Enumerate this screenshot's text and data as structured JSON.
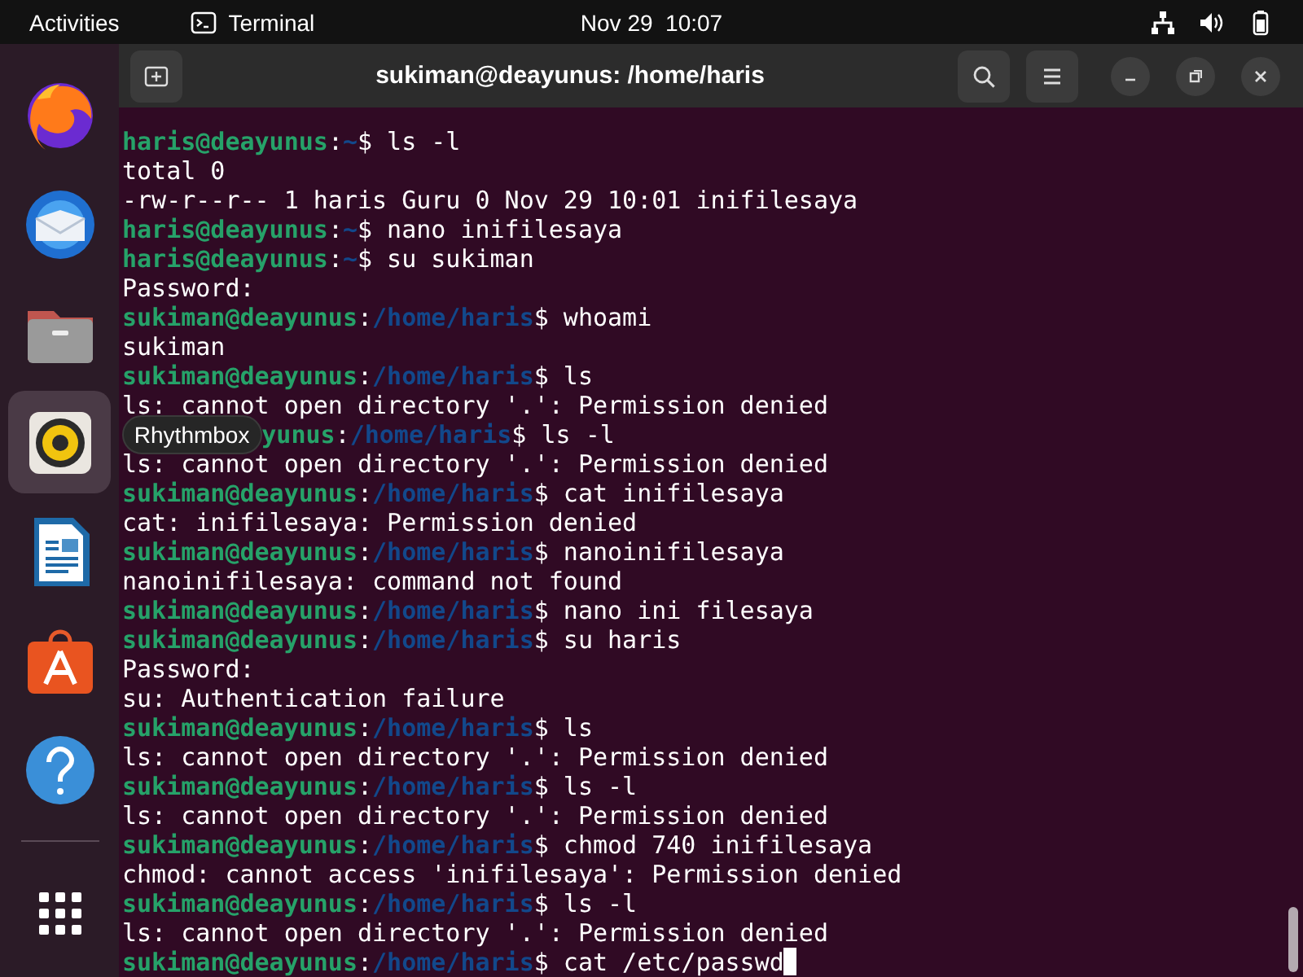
{
  "top_bar": {
    "activities": "Activities",
    "app_name": "Terminal",
    "clock": "Nov 29  10:07"
  },
  "dock": {
    "items": [
      {
        "kind": "browser",
        "hovered": false
      },
      {
        "kind": "mail",
        "hovered": false
      },
      {
        "kind": "files",
        "hovered": false
      },
      {
        "kind": "music",
        "hovered": true
      },
      {
        "kind": "writer",
        "hovered": false
      },
      {
        "kind": "store",
        "hovered": false
      },
      {
        "kind": "help",
        "hovered": false
      }
    ]
  },
  "window": {
    "title": "sukiman@deayunus: /home/haris"
  },
  "terminal": {
    "lines": [
      {
        "kind": "prompt",
        "user_host": "haris@deayunus",
        "sep": ":",
        "path": "~",
        "rest": "$ ls -l"
      },
      {
        "kind": "output",
        "text": "total 0"
      },
      {
        "kind": "output",
        "text": "-rw-r--r-- 1 haris Guru 0 Nov 29 10:01 inifilesaya"
      },
      {
        "kind": "prompt",
        "user_host": "haris@deayunus",
        "sep": ":",
        "path": "~",
        "rest": "$ nano inifilesaya"
      },
      {
        "kind": "prompt",
        "user_host": "haris@deayunus",
        "sep": ":",
        "path": "~",
        "rest": "$ su sukiman"
      },
      {
        "kind": "output",
        "text": "Password:"
      },
      {
        "kind": "prompt",
        "user_host": "sukiman@deayunus",
        "sep": ":",
        "path": "/home/haris",
        "rest": "$ whoami"
      },
      {
        "kind": "output",
        "text": "sukiman"
      },
      {
        "kind": "prompt",
        "user_host": "sukiman@deayunus",
        "sep": ":",
        "path": "/home/haris",
        "rest": "$ ls"
      },
      {
        "kind": "output",
        "text": "ls: cannot open directory '.': Permission denied"
      },
      {
        "kind": "prompt",
        "tooltip": "Rhythmbox",
        "user_host": "yunus",
        "sep": ":",
        "path": "/home/haris",
        "rest": "$ ls -l"
      },
      {
        "kind": "output",
        "text": "ls: cannot open directory '.': Permission denied"
      },
      {
        "kind": "prompt",
        "user_host": "sukiman@deayunus",
        "sep": ":",
        "path": "/home/haris",
        "rest": "$ cat inifilesaya"
      },
      {
        "kind": "output",
        "text": "cat: inifilesaya: Permission denied"
      },
      {
        "kind": "prompt",
        "user_host": "sukiman@deayunus",
        "sep": ":",
        "path": "/home/haris",
        "rest": "$ nanoinifilesaya"
      },
      {
        "kind": "output",
        "text": "nanoinifilesaya: command not found"
      },
      {
        "kind": "prompt",
        "user_host": "sukiman@deayunus",
        "sep": ":",
        "path": "/home/haris",
        "rest": "$ nano ini filesaya"
      },
      {
        "kind": "prompt",
        "user_host": "sukiman@deayunus",
        "sep": ":",
        "path": "/home/haris",
        "rest": "$ su haris"
      },
      {
        "kind": "output",
        "text": "Password:"
      },
      {
        "kind": "output",
        "text": "su: Authentication failure"
      },
      {
        "kind": "prompt",
        "user_host": "sukiman@deayunus",
        "sep": ":",
        "path": "/home/haris",
        "rest": "$ ls"
      },
      {
        "kind": "output",
        "text": "ls: cannot open directory '.': Permission denied"
      },
      {
        "kind": "prompt",
        "user_host": "sukiman@deayunus",
        "sep": ":",
        "path": "/home/haris",
        "rest": "$ ls -l"
      },
      {
        "kind": "output",
        "text": "ls: cannot open directory '.': Permission denied"
      },
      {
        "kind": "prompt",
        "user_host": "sukiman@deayunus",
        "sep": ":",
        "path": "/home/haris",
        "rest": "$ chmod 740 inifilesaya"
      },
      {
        "kind": "output",
        "text": "chmod: cannot access 'inifilesaya': Permission denied"
      },
      {
        "kind": "prompt",
        "user_host": "sukiman@deayunus",
        "sep": ":",
        "path": "/home/haris",
        "rest": "$ ls -l"
      },
      {
        "kind": "output",
        "text": "ls: cannot open directory '.': Permission denied"
      },
      {
        "kind": "prompt",
        "user_host": "sukiman@deayunus",
        "sep": ":",
        "path": "/home/haris",
        "rest": "$ cat /etc/passwd",
        "cursor": true
      }
    ]
  }
}
